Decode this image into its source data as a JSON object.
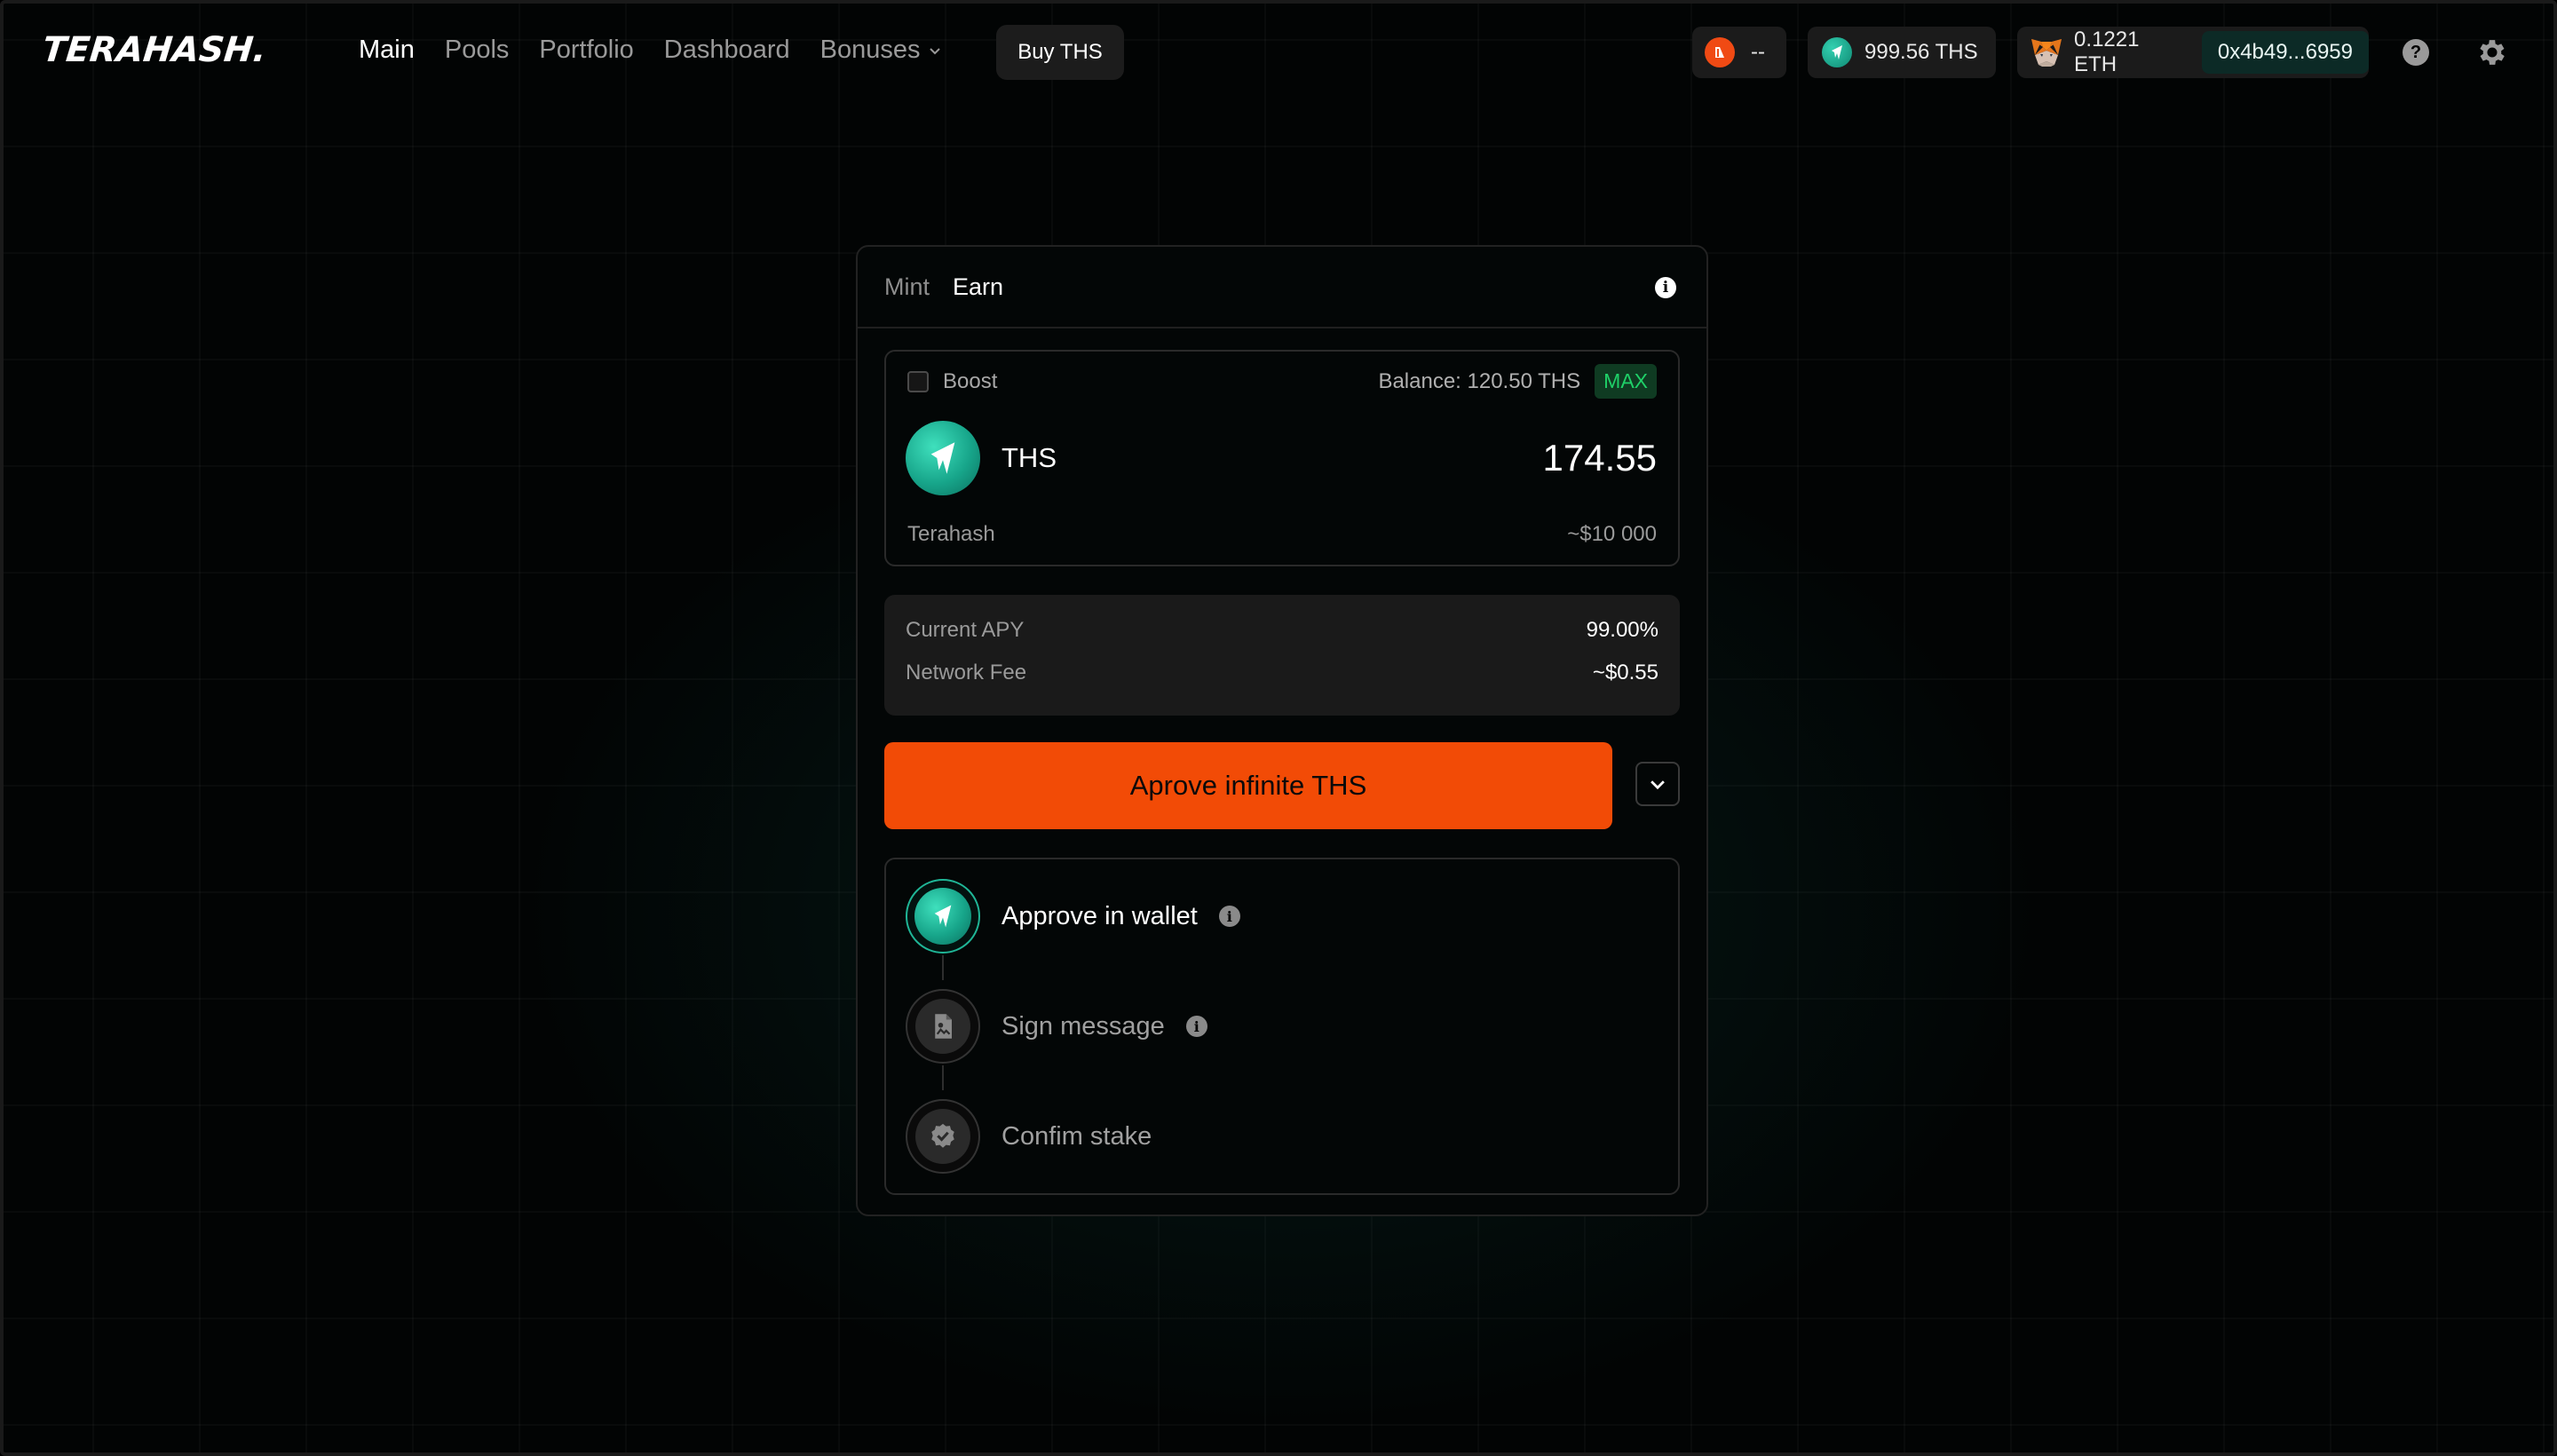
{
  "brand": {
    "logo_text": "TERAHASH."
  },
  "nav": {
    "items": [
      {
        "label": "Main",
        "active": true
      },
      {
        "label": "Pools",
        "active": false
      },
      {
        "label": "Portfolio",
        "active": false
      },
      {
        "label": "Dashboard",
        "active": false
      },
      {
        "label": "Bonuses",
        "active": false,
        "has_dropdown": true
      }
    ],
    "buy_label": "Buy THS"
  },
  "header_right": {
    "points_value": "--",
    "ths_balance": "999.56 THS",
    "eth_balance": "0.1221 ETH",
    "wallet_address": "0x4b49...6959",
    "help_icon": "question-icon",
    "settings_icon": "gear-icon"
  },
  "card": {
    "tabs": [
      {
        "label": "Mint",
        "active": false
      },
      {
        "label": "Earn",
        "active": true
      }
    ],
    "input": {
      "boost_label": "Boost",
      "boost_checked": false,
      "balance_text": "Balance: 120.50 THS",
      "max_label": "MAX",
      "token_symbol": "THS",
      "amount": "174.55",
      "token_name": "Terahash",
      "usd_value": "~$10 000"
    },
    "info": [
      {
        "label": "Current APY",
        "value": "99.00%"
      },
      {
        "label": "Network Fee",
        "value": "~$0.55"
      }
    ],
    "primary_button": "Aprove infinite THS",
    "steps": [
      {
        "label": "Approve in wallet",
        "state": "active",
        "has_info": true,
        "icon": "ths-logo-icon"
      },
      {
        "label": "Sign message",
        "state": "idle",
        "has_info": true,
        "icon": "document-sign-icon"
      },
      {
        "label": "Confim stake",
        "state": "idle",
        "has_info": false,
        "icon": "check-badge-icon"
      }
    ]
  },
  "colors": {
    "accent_orange": "#f24b06",
    "accent_teal": "#1fb596",
    "max_green": "#1fd068",
    "background": "#020404"
  }
}
